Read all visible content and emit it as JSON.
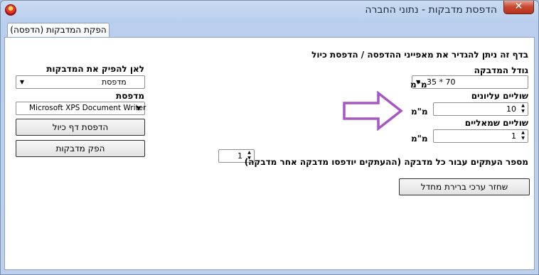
{
  "window": {
    "title": "הדפסת מדבקות - נתוני החברה",
    "close_label": "✕"
  },
  "tab": {
    "label": "הפקת המדבקות (הדפסה)"
  },
  "intro": "בדף זה ניתן להגדיר את מאפייני ההדפסה / הדפסת כיול",
  "label_size": {
    "label": "גודל המדבקה",
    "value": "35 * 70",
    "unit": "מ\"מ"
  },
  "top_margin": {
    "label": "שוליים עליונים",
    "value": "10",
    "unit": "מ\"מ"
  },
  "left_margin": {
    "label": "שוליים שמאליים",
    "value": "1",
    "unit": "מ\"מ"
  },
  "copies": {
    "label": "מספר העתקים עבור כל מדבקה (ההעתקים יודפסו מדבקה אחר מדבקה)",
    "value": "1"
  },
  "restore_button": "שחזר ערכי ברירת מחדל",
  "output": {
    "label": "לאן להפיק את המדבקות",
    "value": "מדפסת"
  },
  "printer": {
    "label": "מדפסת",
    "value": "Microsoft XPS Document Writer"
  },
  "calibration_button": "הדפסת דף כיול",
  "produce_button": "הפק מדבקות",
  "colors": {
    "arrow": "#a757c4",
    "close": "#c94a34"
  }
}
